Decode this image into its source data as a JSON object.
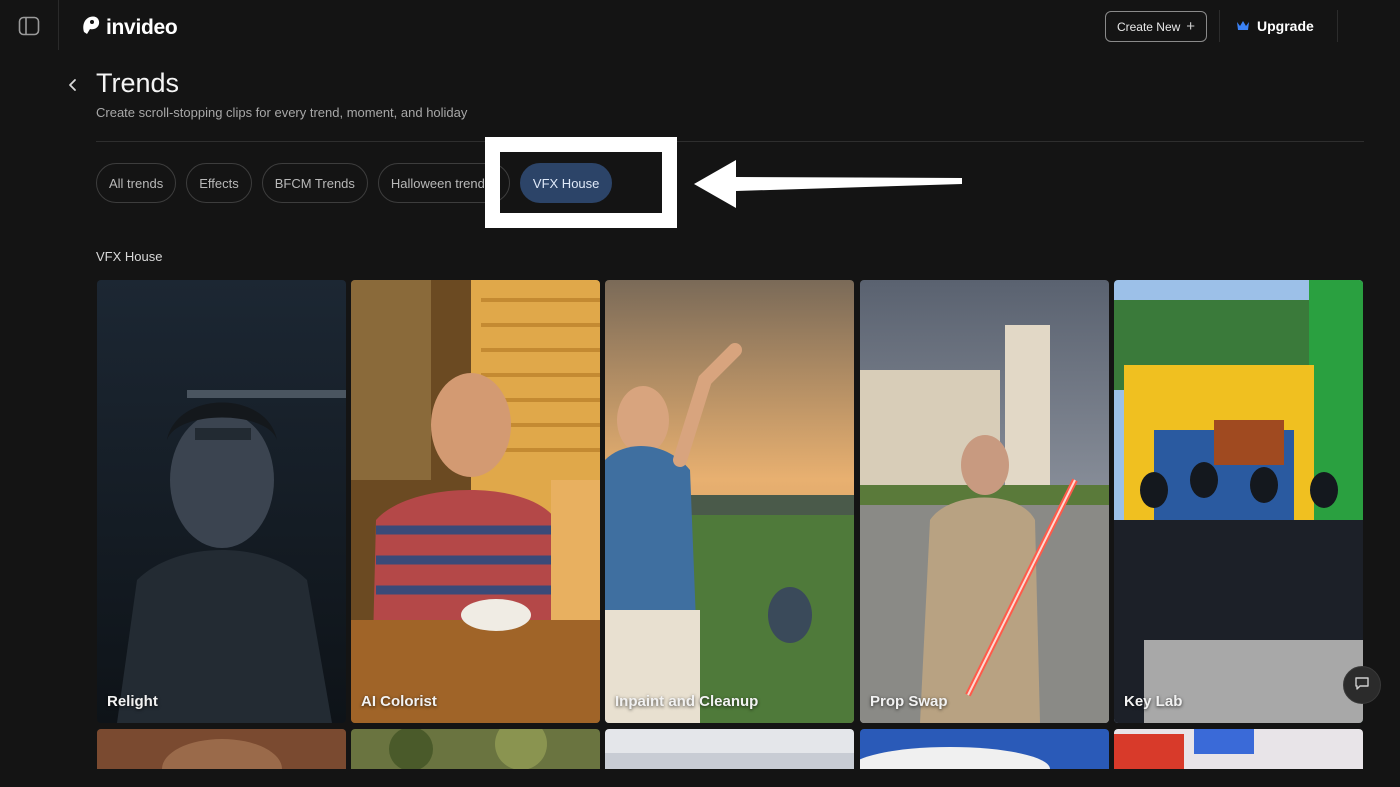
{
  "brand": {
    "name": "invideo"
  },
  "header": {
    "create_label": "Create New",
    "upgrade_label": "Upgrade"
  },
  "page": {
    "title": "Trends",
    "subtitle": "Create scroll-stopping clips for every trend, moment, and holiday"
  },
  "chips": [
    {
      "label": "All trends"
    },
    {
      "label": "Effects"
    },
    {
      "label": "BFCM Trends"
    },
    {
      "label": "Halloween trends"
    },
    {
      "label": "VFX House"
    }
  ],
  "active_chip": "VFX House",
  "section": {
    "title": "VFX House"
  },
  "cards": [
    {
      "label": "Relight"
    },
    {
      "label": "AI Colorist"
    },
    {
      "label": "Inpaint and Cleanup"
    },
    {
      "label": "Prop Swap"
    },
    {
      "label": "Key Lab"
    }
  ],
  "colors": {
    "background": "#141414",
    "active_chip": "#2c4468",
    "upgrade_icon": "#3b82f6"
  },
  "icons": [
    "sidebar-toggle-icon",
    "logo-icon",
    "plus-icon",
    "crown-icon",
    "chevron-left-icon",
    "chat-icon"
  ]
}
